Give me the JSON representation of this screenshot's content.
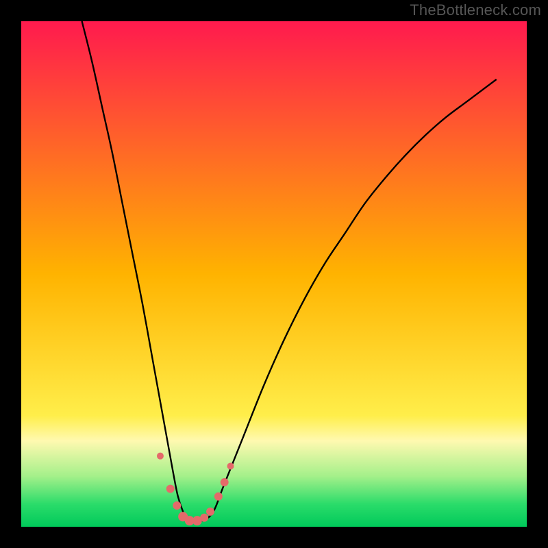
{
  "watermark": {
    "text": "TheBottleneck.com"
  },
  "chart_data": {
    "type": "line",
    "title": "",
    "xlabel": "",
    "ylabel": "",
    "xlim": [
      0,
      100
    ],
    "ylim": [
      0,
      100
    ],
    "background_gradient": {
      "stops": [
        {
          "offset": 0.0,
          "color": "#ff1a4e"
        },
        {
          "offset": 0.5,
          "color": "#ffb300"
        },
        {
          "offset": 0.78,
          "color": "#ffee4a"
        },
        {
          "offset": 0.83,
          "color": "#fff9b0"
        },
        {
          "offset": 0.9,
          "color": "#a4f08a"
        },
        {
          "offset": 0.955,
          "color": "#2bdc6a"
        },
        {
          "offset": 1.0,
          "color": "#00c95a"
        }
      ]
    },
    "series": [
      {
        "name": "curve",
        "color": "#000000",
        "x": [
          12,
          14,
          16,
          18,
          20,
          22,
          24,
          26,
          28,
          30,
          31,
          32,
          33,
          34,
          36,
          38,
          40,
          44,
          48,
          52,
          56,
          60,
          64,
          68,
          72,
          76,
          80,
          84,
          88,
          92,
          94
        ],
        "y": [
          100,
          92,
          83,
          74,
          64,
          54,
          44,
          33,
          22,
          11,
          6,
          3,
          1.2,
          1.0,
          1.3,
          3,
          8,
          18,
          28,
          37,
          45,
          52,
          58,
          64,
          69,
          73.5,
          77.5,
          81,
          84,
          87,
          88.5
        ]
      }
    ],
    "markers": {
      "color": "#e46a6a",
      "points": [
        {
          "x": 27.5,
          "y": 14,
          "r": 5
        },
        {
          "x": 29.5,
          "y": 7.5,
          "r": 6
        },
        {
          "x": 30.8,
          "y": 4.2,
          "r": 6
        },
        {
          "x": 32.0,
          "y": 2.0,
          "r": 7
        },
        {
          "x": 33.3,
          "y": 1.2,
          "r": 7
        },
        {
          "x": 34.8,
          "y": 1.2,
          "r": 7
        },
        {
          "x": 36.2,
          "y": 1.8,
          "r": 6
        },
        {
          "x": 37.4,
          "y": 3.0,
          "r": 6
        },
        {
          "x": 39.0,
          "y": 6.0,
          "r": 6
        },
        {
          "x": 40.2,
          "y": 8.8,
          "r": 6
        },
        {
          "x": 41.4,
          "y": 12.0,
          "r": 5
        }
      ]
    }
  }
}
